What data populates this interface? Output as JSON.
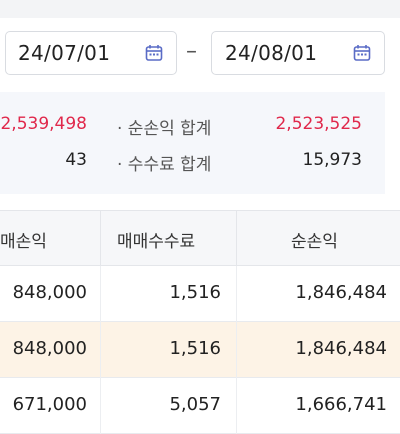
{
  "date_range": {
    "start": "24/07/01",
    "end": "24/08/01",
    "separator": "–",
    "calendar_icon": "calendar-icon"
  },
  "summary": {
    "left_value_1": "2,539,498",
    "left_value_2": "43",
    "right_label_1": "· 순손익 합계",
    "right_value_1": "2,523,525",
    "right_label_2": "· 수수료 합계",
    "right_value_2": "15,973",
    "accent_color": "#e0284b"
  },
  "table": {
    "headers": [
      "매손익",
      "매매수수료",
      "순손익"
    ],
    "rows": [
      {
        "col1": "848,000",
        "col2": "1,516",
        "col3": "1,846,484",
        "highlight": false
      },
      {
        "col1": "848,000",
        "col2": "1,516",
        "col3": "1,846,484",
        "highlight": true
      },
      {
        "col1": "671,000",
        "col2": "5,057",
        "col3": "1,666,741",
        "highlight": false
      }
    ]
  }
}
